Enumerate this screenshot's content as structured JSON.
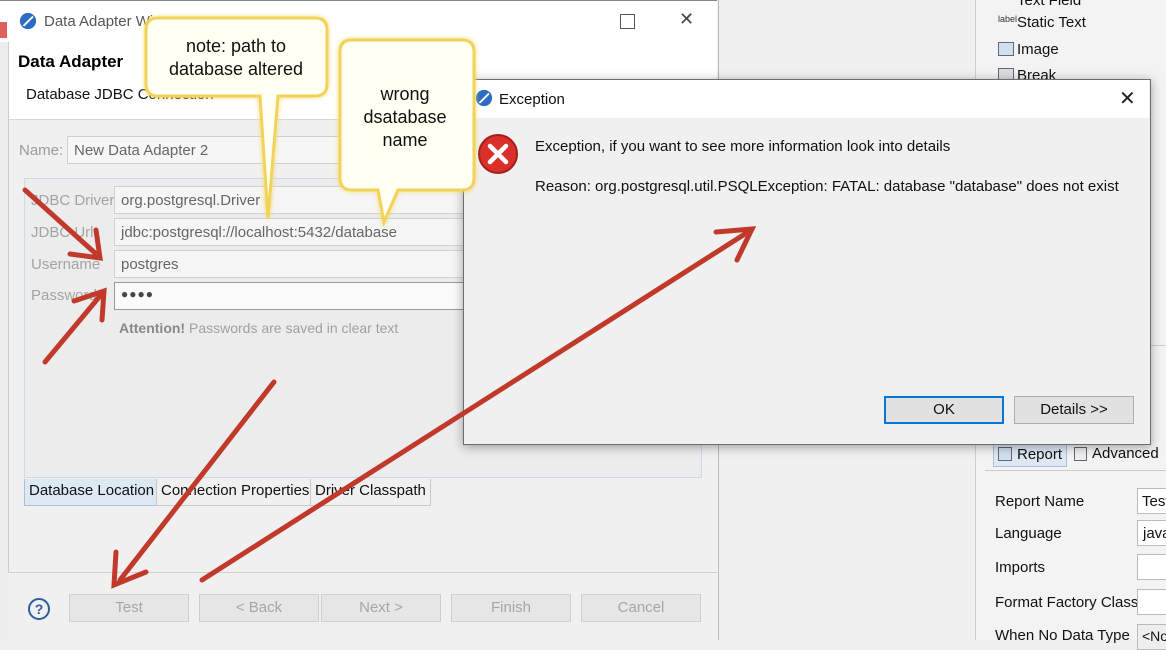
{
  "wizard": {
    "window_title": "Data Adapter Wi",
    "header_title": "Data Adapter",
    "header_subtitle": "Database JDBC Connection",
    "name_label": "Name:",
    "name_value": "New Data Adapter 2",
    "fields": [
      {
        "label": "JDBC Driver",
        "value": "org.postgresql.Driver"
      },
      {
        "label": "JDBC Url",
        "value": "jdbc:postgresql://localhost:5432/database"
      },
      {
        "label": "Username",
        "value": "postgres"
      },
      {
        "label": "Password",
        "value": "●●●●"
      }
    ],
    "attention_strong": "Attention!",
    "attention_text": "Passwords are saved in clear text",
    "tabs": [
      "Database Location",
      "Connection Properties",
      "Driver Classpath"
    ],
    "help_label": "?",
    "buttons": [
      "Test",
      "< Back",
      "Next >",
      "Finish",
      "Cancel"
    ]
  },
  "exception_dialog": {
    "title": "Exception",
    "close_glyph": "✕",
    "message": "Exception, if you want to see more information look into details",
    "reason": "Reason: org.postgresql.util.PSQLException: FATAL: database \"database\" does not exist",
    "ok_label": "OK",
    "details_label": "Details >>"
  },
  "right_panel": {
    "palette_items": [
      "Text Field",
      "Static Text",
      "Image",
      "Break"
    ],
    "label_icon_text": "label",
    "tabs": [
      "Report",
      "Advanced"
    ],
    "properties": [
      {
        "label": "Report Name",
        "value": "Test"
      },
      {
        "label": "Language",
        "value": "java"
      },
      {
        "label": "Imports",
        "value": ""
      },
      {
        "label": "Format Factory Class",
        "value": ""
      },
      {
        "label": "When No Data Type",
        "value": "<No"
      }
    ]
  },
  "callouts": [
    {
      "text": "note: path to database altered"
    },
    {
      "text": "wrong dsatabase name"
    }
  ],
  "colors": {
    "arrow": "#c0392b",
    "callout_fill": "#fffff2",
    "callout_border": "#f2d35a",
    "error_red": "#d9302b",
    "focus_blue": "#0078d7"
  }
}
